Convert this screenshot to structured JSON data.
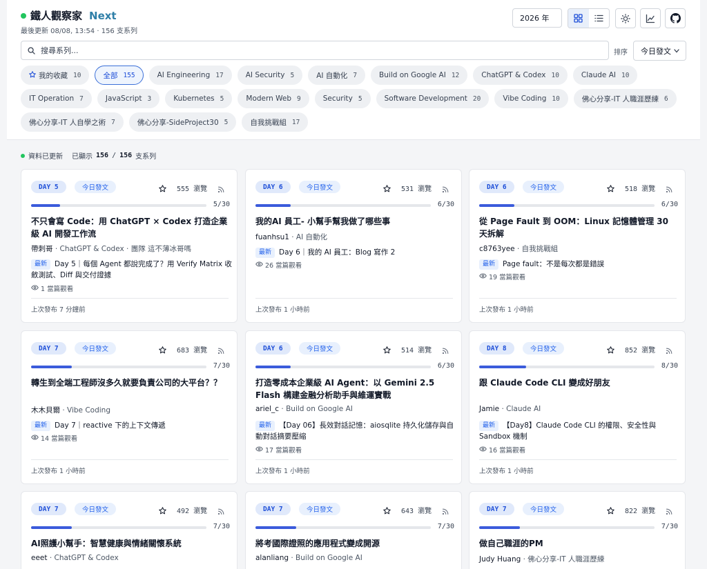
{
  "header": {
    "brand": "鐵人觀察家",
    "brand_suffix": "Next",
    "updated": "最後更新 08/08, 13:54 · 156 支系列",
    "year": "2026 年",
    "icons": [
      "grid-view-icon",
      "list-view-icon",
      "theme-sun-icon",
      "stats-chart-icon",
      "github-icon"
    ],
    "accent_color": "#2f7fa8"
  },
  "search": {
    "placeholder": "搜尋系列..."
  },
  "sort": {
    "label": "排序",
    "value": "今日發文"
  },
  "filters": [
    {
      "label": "我的收藏",
      "count": "10",
      "star": true
    },
    {
      "label": "全部",
      "count": "155",
      "active": true
    },
    {
      "label": "AI Engineering",
      "count": "17"
    },
    {
      "label": "AI Security",
      "count": "5"
    },
    {
      "label": "AI 自動化",
      "count": "7"
    },
    {
      "label": "Build on Google AI",
      "count": "12"
    },
    {
      "label": "ChatGPT & Codex",
      "count": "10"
    },
    {
      "label": "Claude AI",
      "count": "10"
    },
    {
      "label": "IT Operation",
      "count": "7"
    },
    {
      "label": "JavaScript",
      "count": "3"
    },
    {
      "label": "Kubernetes",
      "count": "5"
    },
    {
      "label": "Modern Web",
      "count": "9"
    },
    {
      "label": "Security",
      "count": "5"
    },
    {
      "label": "Software Development",
      "count": "20"
    },
    {
      "label": "Vibe Coding",
      "count": "10"
    },
    {
      "label": "佛心分享-IT 人職涯歷練",
      "count": "6"
    },
    {
      "label": "佛心分享-IT 人自學之術",
      "count": "7"
    },
    {
      "label": "佛心分享-SideProject30",
      "count": "5"
    },
    {
      "label": "自我挑戰組",
      "count": "17"
    }
  ],
  "status": {
    "text": "資料已更新",
    "shown_prefix": "已顯示",
    "shown": "156",
    "sep": "/",
    "total": "156",
    "suffix": "支系列"
  },
  "cards": [
    {
      "day": "DAY 5",
      "badge": "今日發文",
      "views": "555 瀏覽",
      "progress": "5/30",
      "pct": 0.1667,
      "title": "不只會寫 Code：用 ChatGPT × Codex 打造企業級 AI 開發工作流",
      "author": "帶刺哥",
      "meta": "ChatGPT & Codex · 團隊 這不薄冰哥嗎",
      "latest_tag": "最新",
      "latest": "Day 5｜每個 Agent 都說完成了？用 Verify Matrix 收斂測試、Diff 與交付證據",
      "watching": "1 當篇觀看",
      "last": "上次發布 7 分鐘前"
    },
    {
      "day": "DAY 6",
      "badge": "今日發文",
      "views": "531 瀏覽",
      "progress": "6/30",
      "pct": 0.2,
      "title": "我的AI 員工- 小幫手幫我做了哪些事",
      "author": "fuanhsu1",
      "meta": "AI 自動化",
      "latest_tag": "最新",
      "latest": "Day 6｜我的 AI 員工：Blog 寫作 2",
      "watching": "26 當篇觀看",
      "last": "上次發布 1 小時前"
    },
    {
      "day": "DAY 6",
      "badge": "今日發文",
      "views": "518 瀏覽",
      "progress": "6/30",
      "pct": 0.2,
      "title": "從 Page Fault 到 OOM：Linux 記憶體管理 30 天拆解",
      "author": "c8763yee",
      "meta": "自我挑戰組",
      "latest_tag": "最新",
      "latest": "Page fault：不是每次都是錯誤",
      "watching": "19 當篇觀看",
      "last": "上次發布 1 小時前"
    },
    {
      "day": "DAY 7",
      "badge": "今日發文",
      "views": "683 瀏覽",
      "progress": "7/30",
      "pct": 0.2333,
      "title": "轉生到全端工程師沒多久就要負責公司的大平台？？",
      "author": "木木貝爾",
      "meta": "Vibe Coding",
      "latest_tag": "最新",
      "latest": "Day 7｜reactive 下的上下文傳遞",
      "watching": "14 當篇觀看",
      "last": "上次發布 1 小時前"
    },
    {
      "day": "DAY 6",
      "badge": "今日發文",
      "views": "514 瀏覽",
      "progress": "6/30",
      "pct": 0.2,
      "title": "打造零成本企業級 AI Agent：以 Gemini 2.5 Flash 構建金融分析助手與維運實戰",
      "author": "ariel_c",
      "meta": "Build on Google AI",
      "latest_tag": "最新",
      "latest": "【Day 06】長效對話記憶：aiosqlite 持久化儲存與自動對話摘要壓縮",
      "watching": "17 當篇觀看",
      "last": "上次發布 1 小時前"
    },
    {
      "day": "DAY 8",
      "badge": "今日發文",
      "views": "852 瀏覽",
      "progress": "8/30",
      "pct": 0.2667,
      "title": "跟 Claude Code CLI 變成好朋友",
      "author": "Jamie",
      "meta": "Claude AI",
      "latest_tag": "最新",
      "latest": "【Day8】Claude Code CLI 的權限、安全性與 Sandbox 機制",
      "watching": "16 當篇觀看",
      "last": "上次發布 1 小時前"
    },
    {
      "day": "DAY 7",
      "badge": "今日發文",
      "views": "492 瀏覽",
      "progress": "7/30",
      "pct": 0.2333,
      "title": "AI照護小幫手：智慧健康與情緒關懷系統",
      "author": "eeet",
      "meta": "ChatGPT & Codex"
    },
    {
      "day": "DAY 7",
      "badge": "今日發文",
      "views": "643 瀏覽",
      "progress": "7/30",
      "pct": 0.2333,
      "title": "將考國際證照的應用程式變成開源",
      "author": "alanliang",
      "meta": "Build on Google AI"
    },
    {
      "day": "DAY 7",
      "badge": "今日發文",
      "views": "822 瀏覽",
      "progress": "7/30",
      "pct": 0.2333,
      "title": "做自己職涯的PM",
      "author": "Judy Huang",
      "meta": "佛心分享-IT 人職涯歷練"
    }
  ]
}
